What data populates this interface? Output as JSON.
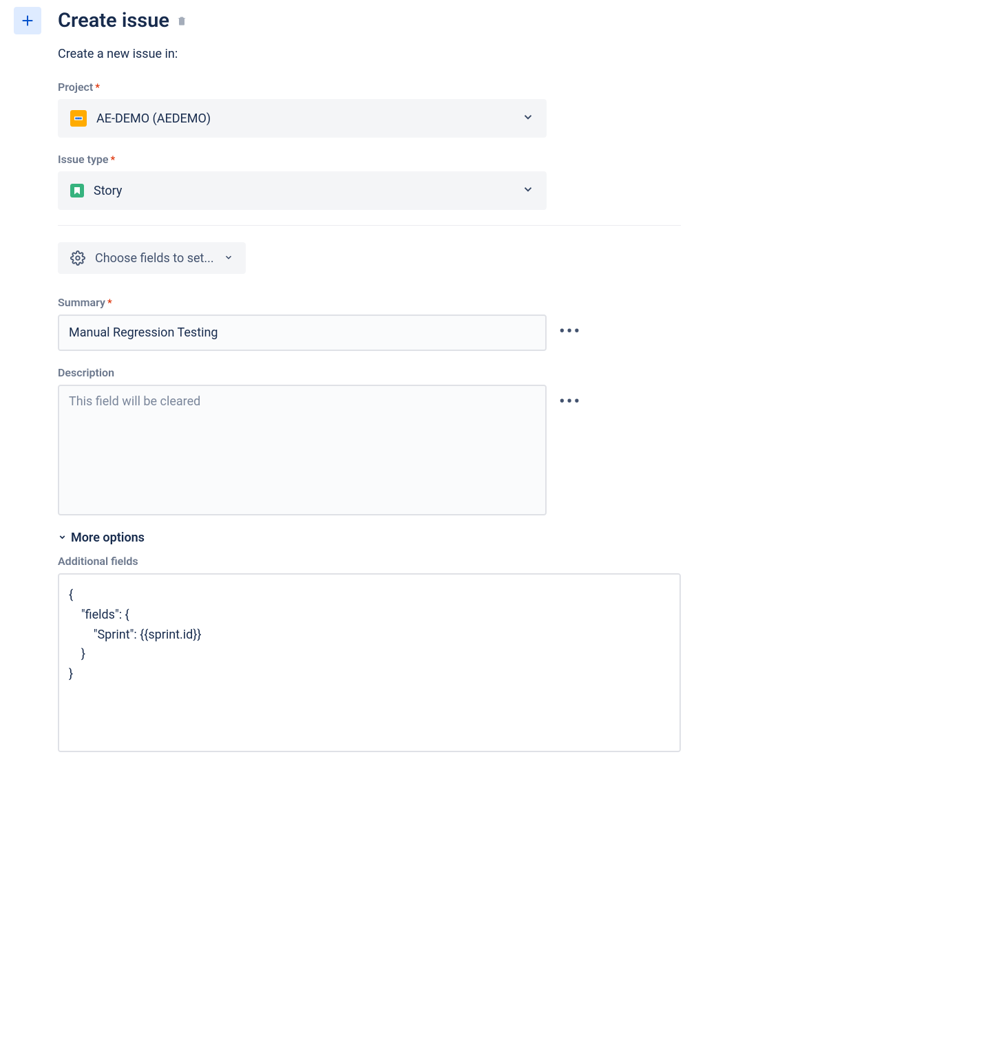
{
  "header": {
    "title": "Create issue",
    "subtitle": "Create a new issue in:"
  },
  "fields": {
    "project": {
      "label": "Project",
      "value": "AE-DEMO (AEDEMO)"
    },
    "issueType": {
      "label": "Issue type",
      "value": "Story"
    },
    "chooseFields": "Choose fields to set...",
    "summary": {
      "label": "Summary",
      "value": "Manual Regression Testing"
    },
    "description": {
      "label": "Description",
      "placeholder": "This field will be cleared"
    },
    "moreOptions": "More options",
    "additionalFields": {
      "label": "Additional fields",
      "value": "{\n    \"fields\": {\n        \"Sprint\": {{sprint.id}}\n    }\n}"
    }
  }
}
